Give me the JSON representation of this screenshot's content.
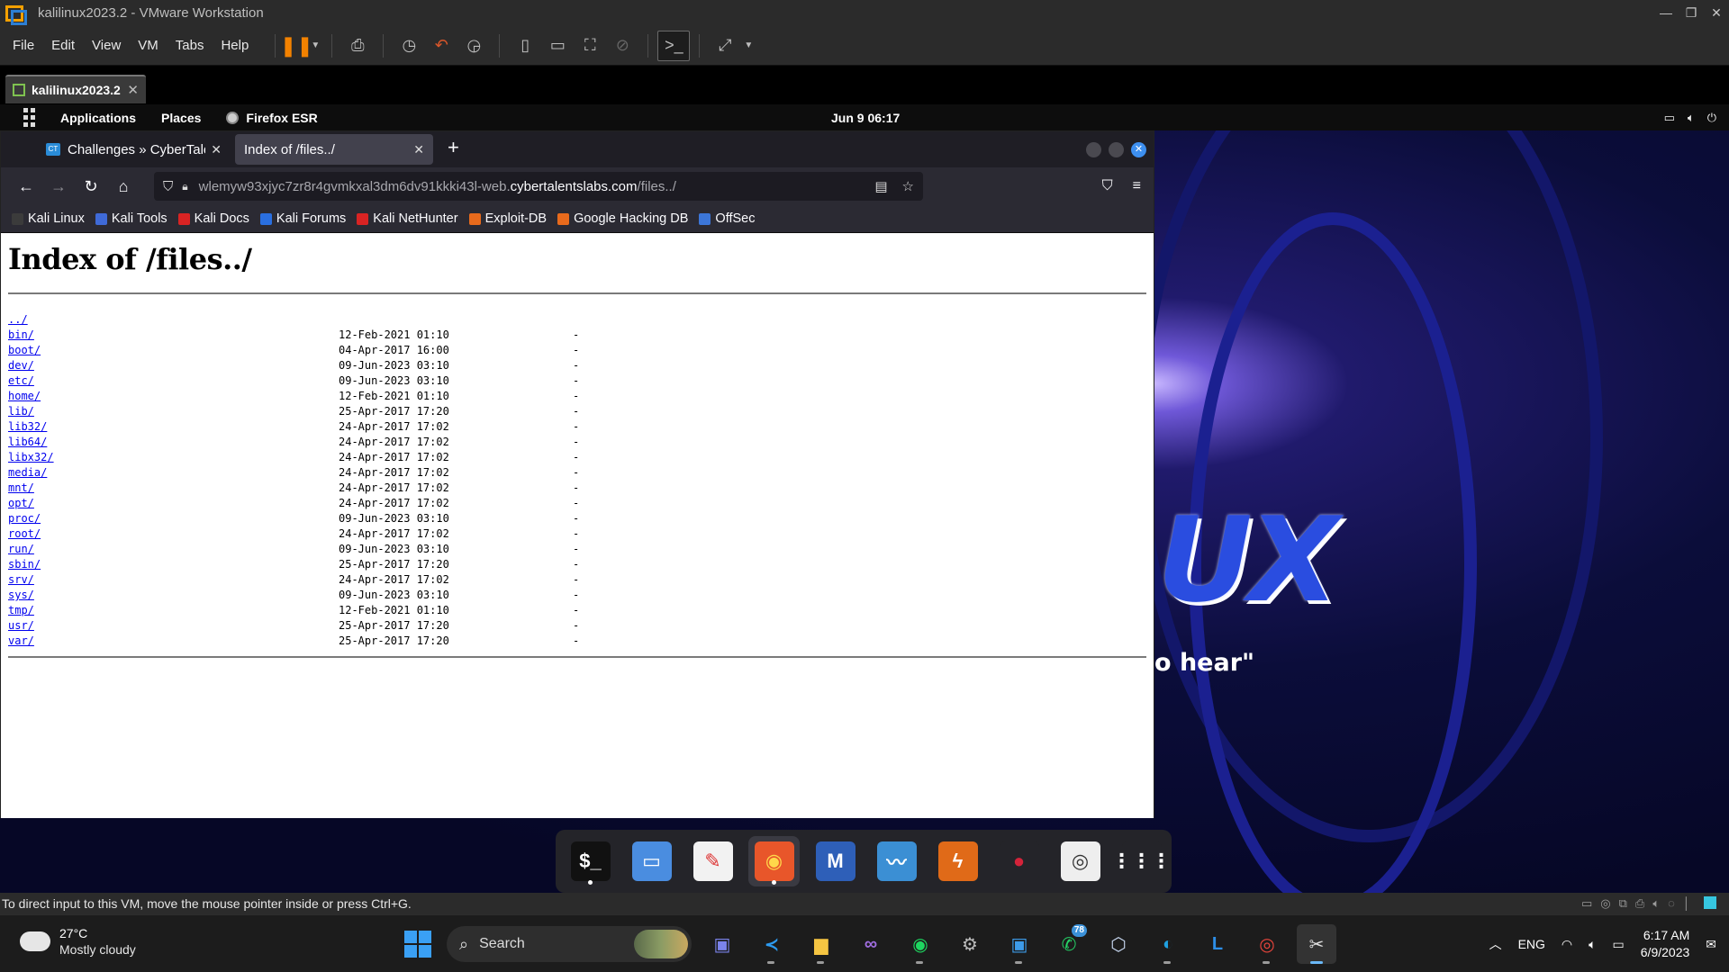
{
  "vmware": {
    "title": "kalilinux2023.2 - VMware Workstation",
    "menu": [
      "File",
      "Edit",
      "View",
      "VM",
      "Tabs",
      "Help"
    ],
    "vm_tab_label": "kalilinux2023.2",
    "status_hint": "To direct input to this VM, move the mouse pointer inside or press Ctrl+G."
  },
  "kali_panel": {
    "applications": "Applications",
    "places": "Places",
    "active_app": "Firefox ESR",
    "clock": "Jun 9  06:17"
  },
  "firefox": {
    "tabs": [
      {
        "label": "Challenges » CyberTalent",
        "active": false
      },
      {
        "label": "Index of /files../",
        "active": true
      }
    ],
    "url_prefix": "wlemyw93xjyc7zr8r4gvmkxal3dm6dv91kkki43l-web.",
    "url_domain": "cybertalentslabs.com",
    "url_path": "/files../",
    "bookmarks": [
      {
        "label": "Kali Linux",
        "color": "#3b3b3b"
      },
      {
        "label": "Kali Tools",
        "color": "#3f6ad8"
      },
      {
        "label": "Kali Docs",
        "color": "#d92323"
      },
      {
        "label": "Kali Forums",
        "color": "#2a6fe0"
      },
      {
        "label": "Kali NetHunter",
        "color": "#d92323"
      },
      {
        "label": "Exploit-DB",
        "color": "#e86a1c"
      },
      {
        "label": "Google Hacking DB",
        "color": "#e86a1c"
      },
      {
        "label": "OffSec",
        "color": "#3c76d8"
      }
    ]
  },
  "page": {
    "heading": "Index of /files../",
    "parent_link": "../",
    "entries": [
      {
        "name": "bin/",
        "date": "12-Feb-2021 01:10",
        "size": "-"
      },
      {
        "name": "boot/",
        "date": "04-Apr-2017 16:00",
        "size": "-"
      },
      {
        "name": "dev/",
        "date": "09-Jun-2023 03:10",
        "size": "-"
      },
      {
        "name": "etc/",
        "date": "09-Jun-2023 03:10",
        "size": "-"
      },
      {
        "name": "home/",
        "date": "12-Feb-2021 01:10",
        "size": "-"
      },
      {
        "name": "lib/",
        "date": "25-Apr-2017 17:20",
        "size": "-"
      },
      {
        "name": "lib32/",
        "date": "24-Apr-2017 17:02",
        "size": "-"
      },
      {
        "name": "lib64/",
        "date": "24-Apr-2017 17:02",
        "size": "-"
      },
      {
        "name": "libx32/",
        "date": "24-Apr-2017 17:02",
        "size": "-"
      },
      {
        "name": "media/",
        "date": "24-Apr-2017 17:02",
        "size": "-"
      },
      {
        "name": "mnt/",
        "date": "24-Apr-2017 17:02",
        "size": "-"
      },
      {
        "name": "opt/",
        "date": "24-Apr-2017 17:02",
        "size": "-"
      },
      {
        "name": "proc/",
        "date": "09-Jun-2023 03:10",
        "size": "-"
      },
      {
        "name": "root/",
        "date": "24-Apr-2017 17:02",
        "size": "-"
      },
      {
        "name": "run/",
        "date": "09-Jun-2023 03:10",
        "size": "-"
      },
      {
        "name": "sbin/",
        "date": "25-Apr-2017 17:20",
        "size": "-"
      },
      {
        "name": "srv/",
        "date": "24-Apr-2017 17:02",
        "size": "-"
      },
      {
        "name": "sys/",
        "date": "09-Jun-2023 03:10",
        "size": "-"
      },
      {
        "name": "tmp/",
        "date": "12-Feb-2021 01:10",
        "size": "-"
      },
      {
        "name": "usr/",
        "date": "25-Apr-2017 17:20",
        "size": "-"
      },
      {
        "name": "var/",
        "date": "25-Apr-2017 17:20",
        "size": "-"
      }
    ]
  },
  "desktop": {
    "bg_text_ux": "UX",
    "bg_text_hear": "o hear\""
  },
  "dock": [
    {
      "name": "terminal-icon",
      "glyph": "$_",
      "bg": "#111",
      "fg": "#fff",
      "running": true,
      "active": false
    },
    {
      "name": "files-icon",
      "glyph": "▭",
      "bg": "#4a8de0",
      "fg": "#fff",
      "running": false,
      "active": false
    },
    {
      "name": "text-editor-icon",
      "glyph": "✎",
      "bg": "#f2f2f2",
      "fg": "#d33",
      "running": false,
      "active": false
    },
    {
      "name": "firefox-icon",
      "glyph": "◉",
      "bg": "#e8562a",
      "fg": "#ffd84a",
      "running": true,
      "active": true
    },
    {
      "name": "metasploit-icon",
      "glyph": "M",
      "bg": "#2e5fb8",
      "fg": "#fff",
      "running": false,
      "active": false
    },
    {
      "name": "wireshark-icon",
      "glyph": "〰",
      "bg": "#3b8fd4",
      "fg": "#fff",
      "running": false,
      "active": false
    },
    {
      "name": "burpsuite-icon",
      "glyph": "ϟ",
      "bg": "#e06a18",
      "fg": "#fff",
      "running": false,
      "active": false
    },
    {
      "name": "cherrytree-icon",
      "glyph": "●",
      "bg": "#242429",
      "fg": "#d4233a",
      "running": false,
      "active": false
    },
    {
      "name": "disk-icon",
      "glyph": "◎",
      "bg": "#eeeeee",
      "fg": "#333",
      "running": false,
      "active": false
    },
    {
      "name": "app-grid-icon",
      "glyph": "⋮⋮⋮",
      "bg": "#242429",
      "fg": "#fff",
      "running": false,
      "active": false
    }
  ],
  "taskbar": {
    "weather_temp": "27°C",
    "weather_desc": "Mostly cloudy",
    "search_label": "Search",
    "apps": [
      {
        "name": "meet-icon",
        "glyph": "▣",
        "color": "#7b83eb",
        "running": false
      },
      {
        "name": "vscode-icon",
        "glyph": "≺",
        "color": "#2d9bf0",
        "running": true
      },
      {
        "name": "file-explorer-icon",
        "glyph": "▆",
        "color": "#f5c542",
        "running": true
      },
      {
        "name": "visual-studio-icon",
        "glyph": "∞",
        "color": "#a06ee0",
        "running": false
      },
      {
        "name": "spotify-icon",
        "glyph": "◉",
        "color": "#1ed760",
        "running": true
      },
      {
        "name": "settings-icon",
        "glyph": "⚙",
        "color": "#bbbbbb",
        "running": false
      },
      {
        "name": "vmware-icon",
        "glyph": "▣",
        "color": "#3d9be9",
        "running": true
      },
      {
        "name": "whatsapp-icon",
        "glyph": "✆",
        "color": "#25d366",
        "running": false,
        "badge": "78"
      },
      {
        "name": "virtualbox-icon",
        "glyph": "⬡",
        "color": "#c7d7f0",
        "running": false
      },
      {
        "name": "edge-icon",
        "glyph": "◐",
        "color": "#1fa0e0",
        "running": true
      },
      {
        "name": "l-app-icon",
        "glyph": "L",
        "color": "#2d8fe8",
        "running": false
      },
      {
        "name": "chrome-icon",
        "glyph": "◎",
        "color": "#e8453c",
        "running": true
      },
      {
        "name": "snipping-tool-icon",
        "glyph": "✂",
        "color": "#e0e0e0",
        "running": true,
        "active": true
      }
    ],
    "lang": "ENG",
    "time": "6:17 AM",
    "date": "6/9/2023"
  }
}
